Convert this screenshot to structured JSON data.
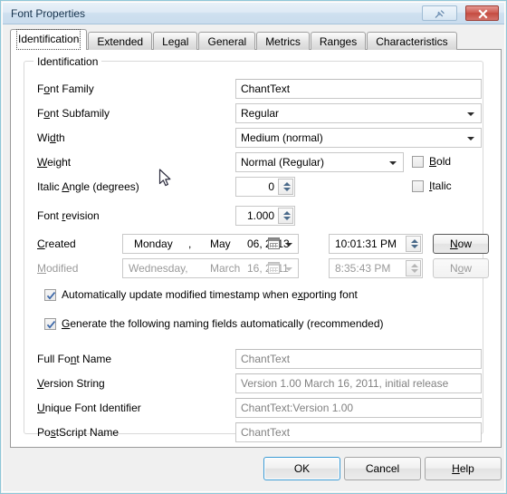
{
  "window": {
    "title": "Font Properties",
    "pin_icon": "pushpin-icon",
    "close_icon": "close-icon",
    "border_color": "#8ec7d8",
    "titlebar_color": "#cfe0ef",
    "close_button_color": "#c44b40"
  },
  "tabs": [
    {
      "label": "Identification",
      "active": true
    },
    {
      "label": "Extended",
      "active": false
    },
    {
      "label": "Legal",
      "active": false
    },
    {
      "label": "General",
      "active": false
    },
    {
      "label": "Metrics",
      "active": false
    },
    {
      "label": "Ranges",
      "active": false
    },
    {
      "label": "Characteristics",
      "active": false
    }
  ],
  "group": {
    "legend": "Identification"
  },
  "fields": {
    "font_family": {
      "label_pre": "F",
      "label_accel": "o",
      "label_post": "nt Family",
      "value": "ChantText"
    },
    "font_subfamily": {
      "label_pre": "F",
      "label_accel": "o",
      "label_post": "nt Subfamily",
      "value": "Regular"
    },
    "width": {
      "label_pre": "Wi",
      "label_accel": "d",
      "label_post": "th",
      "value": "Medium (normal)"
    },
    "weight": {
      "label_pre": "",
      "label_accel": "W",
      "label_post": "eight",
      "value": "Normal (Regular)"
    },
    "italic_angle": {
      "label_pre": "Italic ",
      "label_accel": "A",
      "label_post": "ngle (degrees)",
      "value": "0"
    },
    "font_revision": {
      "label_pre": "Font ",
      "label_accel": "r",
      "label_post": "evision",
      "value": "1.000"
    },
    "bold": {
      "label_pre": "",
      "label_accel": "B",
      "label_post": "old",
      "checked": false
    },
    "italic": {
      "label_pre": "",
      "label_accel": "I",
      "label_post": "talic",
      "checked": false
    }
  },
  "created": {
    "label_pre": "",
    "label_accel": "C",
    "label_post": "reated",
    "enabled": true,
    "weekday": "Monday",
    "separator": ",",
    "month": "May",
    "daynum_year": "06, 2013",
    "time": "10:01:31 PM",
    "now_pre": "",
    "now_accel": "N",
    "now_post": "ow"
  },
  "modified": {
    "label_pre": "",
    "label_accel": "M",
    "label_post": "odified",
    "enabled": false,
    "weekday": "Wednesday,",
    "separator": "",
    "month": "March",
    "daynum_year": "16, 2011",
    "time": "8:35:43 PM",
    "now_pre": "N",
    "now_accel": "o",
    "now_post": "w"
  },
  "checkboxes": {
    "auto_update": {
      "pre": "Automatically update modified timestamp when e",
      "accel": "x",
      "post": "porting font",
      "checked": true
    },
    "generate_naming": {
      "pre": "",
      "accel": "G",
      "post": "enerate the following naming fields automatically (recommended)",
      "checked": true
    }
  },
  "naming": {
    "full_font_name": {
      "label_pre": "Full Fo",
      "label_accel": "n",
      "label_post": "t Name",
      "value": "ChantText"
    },
    "version_string": {
      "label_pre": "",
      "label_accel": "V",
      "label_post": "ersion String",
      "value": "Version 1.00 March 16, 2011, initial release"
    },
    "unique_font_identifier": {
      "label_pre": "",
      "label_accel": "U",
      "label_post": "nique Font Identifier",
      "value": "ChantText:Version 1.00"
    },
    "postscript_name": {
      "label_pre": "Po",
      "label_accel": "s",
      "label_post": "tScript Name",
      "value": "ChantText"
    }
  },
  "buttons": {
    "ok": "OK",
    "cancel": "Cancel",
    "help_pre": "",
    "help_accel": "H",
    "help_post": "elp",
    "default_focus_color": "#3c9bd4"
  }
}
